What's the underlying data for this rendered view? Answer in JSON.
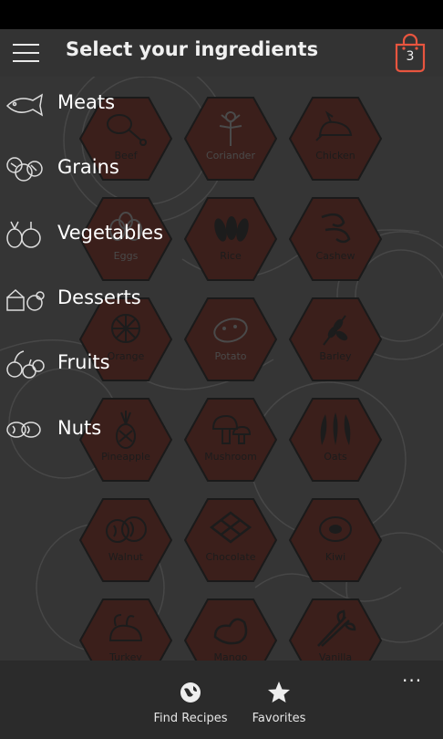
{
  "header": {
    "title": "Select your ingredients",
    "cart_count": "3"
  },
  "menu": [
    {
      "label": "Meats",
      "icon": "fish-icon"
    },
    {
      "label": "Grains",
      "icon": "grains-icon"
    },
    {
      "label": "Vegetables",
      "icon": "vegetables-icon"
    },
    {
      "label": "Desserts",
      "icon": "desserts-icon"
    },
    {
      "label": "Fruits",
      "icon": "fruits-icon"
    },
    {
      "label": "Nuts",
      "icon": "nuts-icon"
    }
  ],
  "ingredients": [
    {
      "label": "Beef",
      "icon": "beef-icon"
    },
    {
      "label": "Coriander",
      "icon": "coriander-icon"
    },
    {
      "label": "Chicken",
      "icon": "chicken-icon"
    },
    {
      "label": "Eggs",
      "icon": "eggs-icon"
    },
    {
      "label": "Rice",
      "icon": "rice-icon"
    },
    {
      "label": "Cashew",
      "icon": "cashew-icon"
    },
    {
      "label": "Orange",
      "icon": "orange-icon"
    },
    {
      "label": "Potato",
      "icon": "potato-icon"
    },
    {
      "label": "Barley",
      "icon": "barley-icon"
    },
    {
      "label": "Pineapple",
      "icon": "pineapple-icon"
    },
    {
      "label": "Mushroom",
      "icon": "mushroom-icon"
    },
    {
      "label": "Oats",
      "icon": "oats-icon"
    },
    {
      "label": "Walnut",
      "icon": "walnut-icon"
    },
    {
      "label": "Chocolate",
      "icon": "chocolate-icon"
    },
    {
      "label": "Kiwi",
      "icon": "kiwi-icon"
    },
    {
      "label": "Turkey",
      "icon": "turkey-icon"
    },
    {
      "label": "Mango",
      "icon": "mango-icon"
    },
    {
      "label": "Vanilla",
      "icon": "vanilla-icon"
    }
  ],
  "bottom_bar": {
    "more_label": "...",
    "find_recipes_label": "Find Recipes",
    "favorites_label": "Favorites"
  },
  "colors": {
    "hex_fill": "#3b1f1b",
    "hex_stroke": "#1a1a1a",
    "cart_accent": "#e8553f"
  }
}
